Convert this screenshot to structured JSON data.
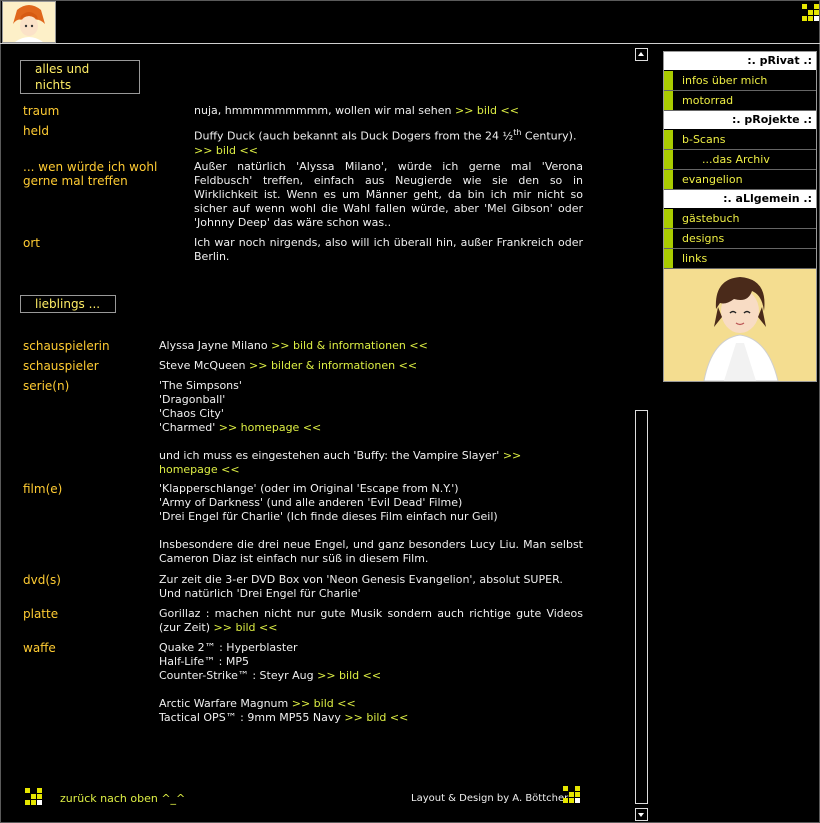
{
  "sections": {
    "alles": "alles und nichts",
    "lieblings": "lieblings ..."
  },
  "alles_rows": [
    {
      "label": "traum",
      "text": "nuja, hmmmmmmmmm, wollen wir mal sehen ",
      "link": ">> bild <<"
    },
    {
      "label": "held",
      "text1": "Duffy Duck (auch bekannt als Duck Dogers from the 24 ½",
      "sup": "th",
      "text2": " Century).",
      "link": ">> bild <<"
    },
    {
      "label": "... wen würde ich wohl gerne mal treffen",
      "text": "Außer natürlich 'Alyssa Milano', würde ich gerne mal 'Verona Feldbusch' treffen, einfach aus Neugierde wie sie den so in Wirklichkeit ist. Wenn es um Männer geht, da bin ich mir nicht so sicher auf wenn wohl die Wahl fallen würde, aber 'Mel Gibson' oder 'Johnny Deep' das wäre schon was.."
    },
    {
      "label": "ort",
      "text": "Ich war noch nirgends, also will ich überall hin, außer Frankreich oder Berlin."
    }
  ],
  "fav": {
    "schauspielerin": {
      "label": "schauspielerin",
      "text": "Alyssa Jayne Milano ",
      "link": ">> bild & informationen <<"
    },
    "schauspieler": {
      "label": "schauspieler",
      "text": "Steve McQueen ",
      "link": ">> bilder & informationen <<"
    },
    "serie": {
      "label": "serie(n)",
      "l1": "'The Simpsons'",
      "l2": "'Dragonball'",
      "l3": "'Chaos City'",
      "l4": "'Charmed' ",
      "link1": ">> homepage <<",
      "l5": "und ich muss es eingestehen auch 'Buffy: the Vampire Slayer' ",
      "link2": ">> homepage <<"
    },
    "film": {
      "label": "film(e)",
      "l1": "'Klapperschlange' (oder im Original 'Escape from N.Y.')",
      "l2": "'Army of Darkness' (und alle anderen 'Evil Dead' Filme)",
      "l3": "'Drei Engel für Charlie' (Ich finde dieses Film einfach nur Geil)",
      "l4": "Insbesondere die drei neue Engel, und ganz besonders Lucy Liu. Man selbst Cameron Diaz ist einfach nur süß in diesem Film."
    },
    "dvd": {
      "label": "dvd(s)",
      "l1": "Zur zeit die 3-er DVD Box von 'Neon Genesis Evangelion', absolut SUPER.",
      "l2": "Und natürlich 'Drei Engel für Charlie'"
    },
    "platte": {
      "label": "platte",
      "text": "Gorillaz : machen nicht nur gute Musik sondern auch richtige gute Videos (zur Zeit) ",
      "link": ">> bild <<"
    },
    "waffe": {
      "label": "waffe",
      "l1": "Quake 2™ : Hyperblaster",
      "l2": "Half-Life™ : MP5",
      "l3": "Counter-Strike™ : Steyr Aug ",
      "link3": ">> bild <<",
      "l4": "Arctic Warfare Magnum ",
      "link4": ">> bild <<",
      "l5": "Tactical OPS™ : 9mm MP55 Navy ",
      "link5": ">> bild <<"
    }
  },
  "footer": {
    "back": "zurück nach oben ^_^",
    "credit": "Layout & Design by A. Böttcher"
  },
  "menu": {
    "privat": ":. pRivat .:",
    "projekte": ":. pRojekte .:",
    "allgemein": ":. aLlgemein .:",
    "items": [
      "infos über mich",
      "motorrad",
      "b-Scans",
      "...das Archiv",
      "evangelion",
      "gästebuch",
      "designs",
      "links"
    ]
  },
  "colors": {
    "label": "#ffcc33",
    "link": "#ddee44",
    "menu_accent": "#aacc00",
    "bg": "#000000"
  }
}
